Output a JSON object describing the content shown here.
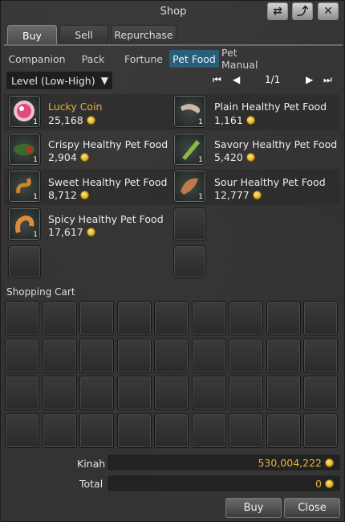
{
  "window": {
    "title": "Shop"
  },
  "titlebar": {
    "refresh": "⇄",
    "popout": "⤴",
    "close": "✕"
  },
  "tabs": [
    "Buy",
    "Sell",
    "Repurchase"
  ],
  "subtabs": [
    "Companion",
    "Pack",
    "Fortune",
    "Pet Food",
    "Pet Manual"
  ],
  "sort": {
    "value": "Level (Low-High)",
    "arrow": "▼"
  },
  "pager": {
    "first": "⏮",
    "prev": "◀",
    "page": "1/1",
    "next": "▶",
    "last": "⏭"
  },
  "items": [
    {
      "name": "Lucky Coin",
      "price": "25,168",
      "count": "1",
      "icon": "lucky-coin-icon",
      "highlight": true
    },
    {
      "name": "Plain Healthy Pet Food",
      "price": "1,161",
      "count": "1",
      "icon": "plain-pet-food-icon"
    },
    {
      "name": "Crispy Healthy Pet Food",
      "price": "2,904",
      "count": "1",
      "icon": "crispy-pet-food-icon"
    },
    {
      "name": "Savory Healthy Pet Food",
      "price": "5,420",
      "count": "1",
      "icon": "savory-pet-food-icon"
    },
    {
      "name": "Sweet Healthy Pet Food",
      "price": "8,712",
      "count": "1",
      "icon": "sweet-pet-food-icon"
    },
    {
      "name": "Sour Healthy Pet Food",
      "price": "12,777",
      "count": "1",
      "icon": "sour-pet-food-icon"
    },
    {
      "name": "Spicy Healthy Pet Food",
      "price": "17,617",
      "count": "1",
      "icon": "spicy-pet-food-icon"
    }
  ],
  "cart": {
    "label": "Shopping Cart"
  },
  "kinah": {
    "label": "Kinah",
    "value": "530,004,222"
  },
  "total": {
    "label": "Total",
    "value": "0"
  },
  "buttons": {
    "buy": "Buy",
    "close": "Close"
  }
}
